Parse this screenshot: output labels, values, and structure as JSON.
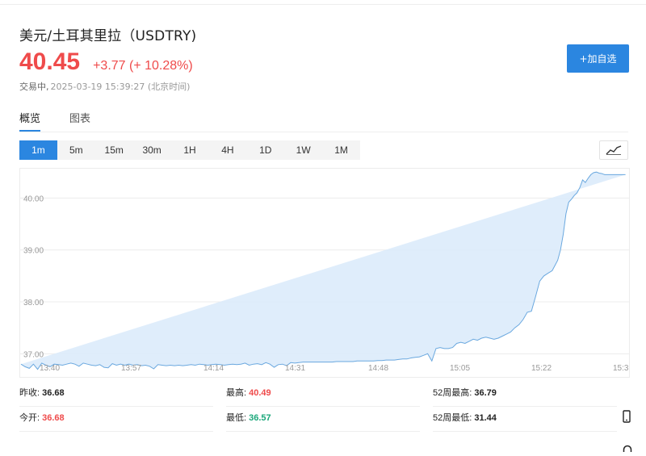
{
  "header": {
    "title": "美元/土耳其里拉（USDTRY)",
    "price": "40.45",
    "change": "+3.77 (+ 10.28%)",
    "status_label": "交易中,",
    "timestamp": "2025-03-19 15:39:27 (北京时间)"
  },
  "actions": {
    "add_watchlist": "+加自选"
  },
  "tabs": [
    {
      "label": "概览",
      "active": true
    },
    {
      "label": "图表",
      "active": false
    }
  ],
  "intervals": [
    {
      "label": "1m",
      "active": true
    },
    {
      "label": "5m"
    },
    {
      "label": "15m"
    },
    {
      "label": "30m"
    },
    {
      "label": "1H"
    },
    {
      "label": "4H"
    },
    {
      "label": "1D"
    },
    {
      "label": "1W"
    },
    {
      "label": "1M"
    }
  ],
  "colors": {
    "up": "#ef4b4b",
    "down": "#1aa77a",
    "accent": "#2b86e0",
    "line": "#6aa8df",
    "fill": "#dcebfb"
  },
  "chart_data": {
    "type": "area",
    "x_ticks": [
      "13:40",
      "13:57",
      "14:14",
      "14:31",
      "14:48",
      "15:05",
      "15:22",
      "15:3"
    ],
    "y_ticks": [
      "40.00",
      "39.00",
      "38.00",
      "37.00"
    ],
    "ylim": [
      36.57,
      40.55
    ],
    "grid": true,
    "x": [
      0,
      3,
      6,
      9,
      12,
      15,
      18,
      21,
      24,
      27,
      30,
      33,
      36,
      39,
      42,
      45,
      48,
      51,
      54,
      57,
      60,
      63,
      66,
      69,
      72,
      75,
      78,
      81,
      84,
      87,
      90,
      93,
      96,
      99,
      102,
      105,
      108,
      111,
      114,
      117,
      120,
      123,
      126,
      129,
      132,
      135,
      138,
      141,
      144,
      147,
      150,
      153,
      156,
      159,
      162,
      165,
      168,
      171,
      174,
      177,
      180,
      183,
      186,
      189,
      192,
      195,
      198,
      201,
      204,
      207,
      210,
      213,
      216,
      219,
      222,
      225,
      228,
      231,
      234,
      237,
      240,
      243,
      246,
      249,
      252,
      255,
      258,
      261,
      264,
      267,
      270,
      273,
      276,
      279,
      282,
      285,
      288,
      291,
      294,
      297,
      300,
      303,
      306,
      309,
      312,
      315,
      318,
      321,
      324,
      327,
      330,
      333,
      336,
      339,
      342,
      345,
      348,
      351,
      354,
      357,
      360,
      363,
      366,
      369,
      372,
      375,
      378,
      381,
      384,
      386,
      388,
      390,
      392,
      394,
      396,
      398,
      400,
      402,
      404,
      406,
      408,
      410,
      412,
      414,
      416,
      418,
      420,
      421,
      422,
      423,
      424,
      425,
      426,
      427,
      428,
      429,
      430,
      431,
      432,
      433,
      434,
      435,
      436,
      437,
      438,
      439
    ],
    "y": [
      36.8,
      36.75,
      36.72,
      36.8,
      36.7,
      36.82,
      36.78,
      36.75,
      36.8,
      36.79,
      36.78,
      36.8,
      36.82,
      36.8,
      36.76,
      36.82,
      36.8,
      36.78,
      36.77,
      36.79,
      36.74,
      36.73,
      36.81,
      36.78,
      36.8,
      36.78,
      36.8,
      36.78,
      36.79,
      36.77,
      36.78,
      36.76,
      36.71,
      36.79,
      36.78,
      36.77,
      36.78,
      36.77,
      36.78,
      36.77,
      36.78,
      36.79,
      36.78,
      36.8,
      36.79,
      36.78,
      36.79,
      36.8,
      36.79,
      36.78,
      36.79,
      36.8,
      36.79,
      36.8,
      36.82,
      36.78,
      36.8,
      36.81,
      36.79,
      36.83,
      36.8,
      36.74,
      36.79,
      36.8,
      36.77,
      36.83,
      36.82,
      36.83,
      36.84,
      36.84,
      36.84,
      36.84,
      36.84,
      36.84,
      36.84,
      36.84,
      36.85,
      36.85,
      36.85,
      36.85,
      36.85,
      36.86,
      36.86,
      36.86,
      36.86,
      36.86,
      36.87,
      36.87,
      36.88,
      36.88,
      36.88,
      36.89,
      36.9,
      36.9,
      36.92,
      36.93,
      36.94,
      36.97,
      37.0,
      36.86,
      37.1,
      37.12,
      37.1,
      37.1,
      37.12,
      37.2,
      37.22,
      37.2,
      37.24,
      37.28,
      37.26,
      37.3,
      37.32,
      37.3,
      37.28,
      37.3,
      37.34,
      37.38,
      37.42,
      37.5,
      37.56,
      37.66,
      37.8,
      37.82,
      38.1,
      38.4,
      38.5,
      38.55,
      38.6,
      38.7,
      38.8,
      39.0,
      39.3,
      39.7,
      39.92,
      39.98,
      40.05,
      40.1,
      40.2,
      40.35,
      40.3,
      40.38,
      40.45,
      40.49,
      40.5,
      40.48,
      40.47,
      40.46,
      40.45,
      40.45,
      40.45,
      40.45,
      40.45,
      40.45,
      40.45,
      40.45,
      40.45,
      40.45,
      40.45,
      40.45,
      40.45,
      40.45,
      40.45,
      40.45
    ]
  },
  "stats": [
    [
      {
        "label": "昨收:",
        "value": "36.68",
        "tone": "neutral"
      },
      {
        "label": "最高:",
        "value": "40.49",
        "tone": "up"
      },
      {
        "label": "52周最高:",
        "value": "36.79",
        "tone": "neutral"
      }
    ],
    [
      {
        "label": "今开:",
        "value": "36.68",
        "tone": "up"
      },
      {
        "label": "最低:",
        "value": "36.57",
        "tone": "down"
      },
      {
        "label": "52周最低:",
        "value": "31.44",
        "tone": "neutral"
      }
    ]
  ]
}
